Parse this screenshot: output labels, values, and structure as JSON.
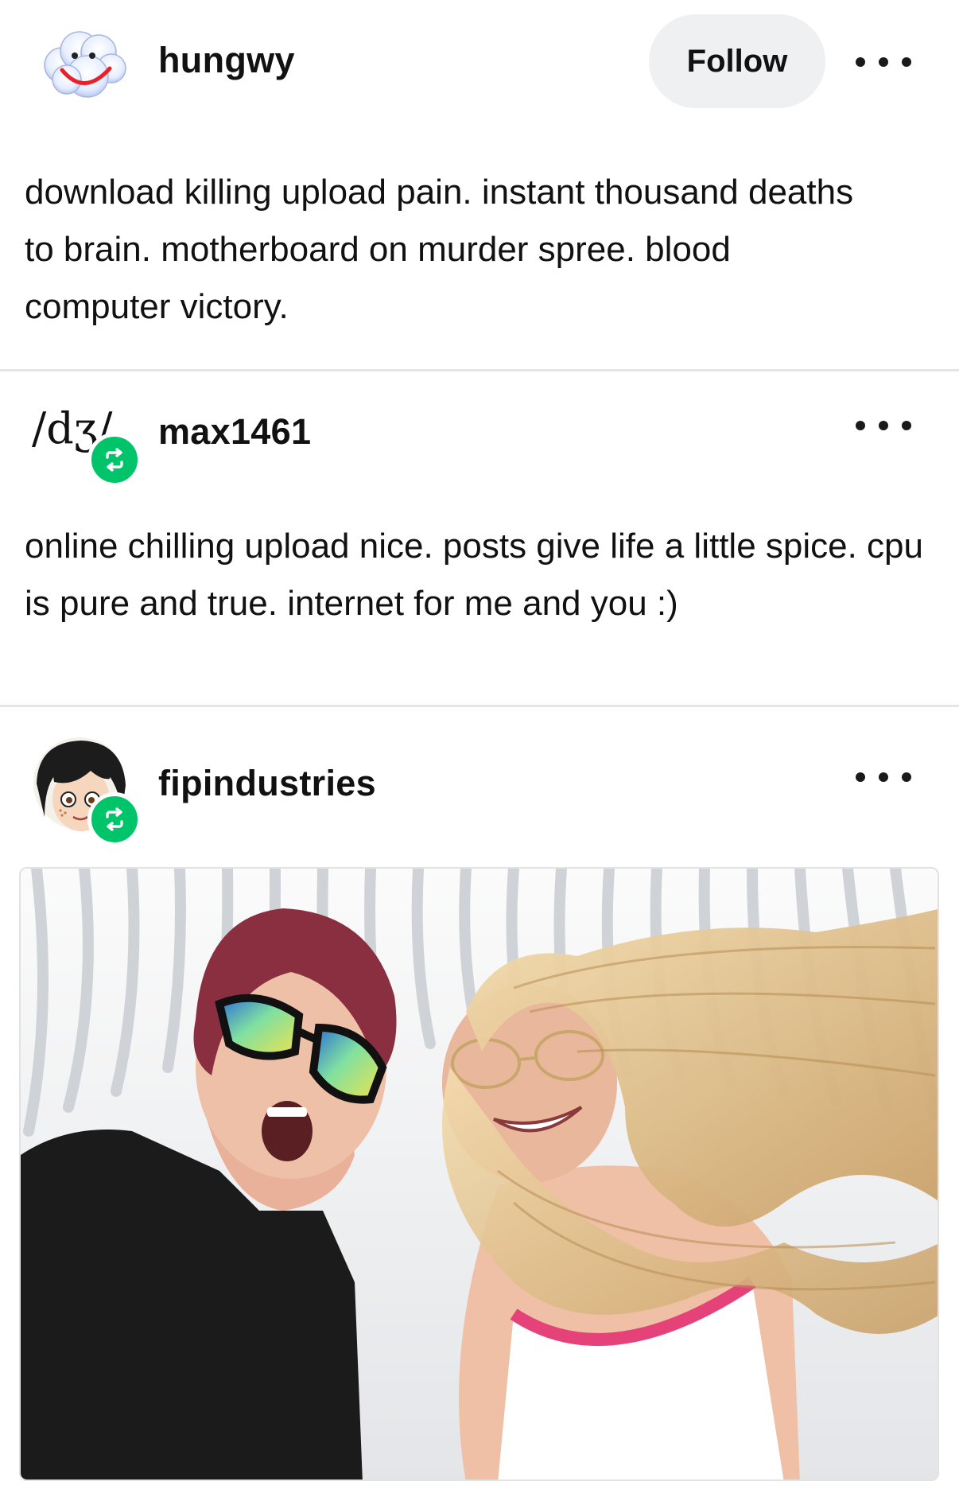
{
  "posts": [
    {
      "username": "hungwy",
      "avatar_icon": "cloud-smiley-icon",
      "follow_label": "Follow",
      "more_icon": "more-options-icon",
      "text": "download killing upload pain. instant thousand deaths to brain. motherboard on murder spree. blood computer victory."
    },
    {
      "username": "max1461",
      "avatar_text": "/dʒ/",
      "avatar_icon": "ipa-avatar-icon",
      "reblog_icon": "reblog-icon",
      "more_icon": "more-options-icon",
      "text": "online chilling upload nice. posts give life a little spice. cpu is pure and true. internet for me and you :)"
    },
    {
      "username": "fipindustries",
      "avatar_icon": "cartoon-face-avatar-icon",
      "reblog_icon": "reblog-icon",
      "more_icon": "more-options-icon",
      "image_icon": "selfie-photo-icon"
    }
  ],
  "colors": {
    "reblog_green": "#00c46a",
    "follow_bg": "#eff0f2",
    "divider": "#e4e4e4"
  }
}
